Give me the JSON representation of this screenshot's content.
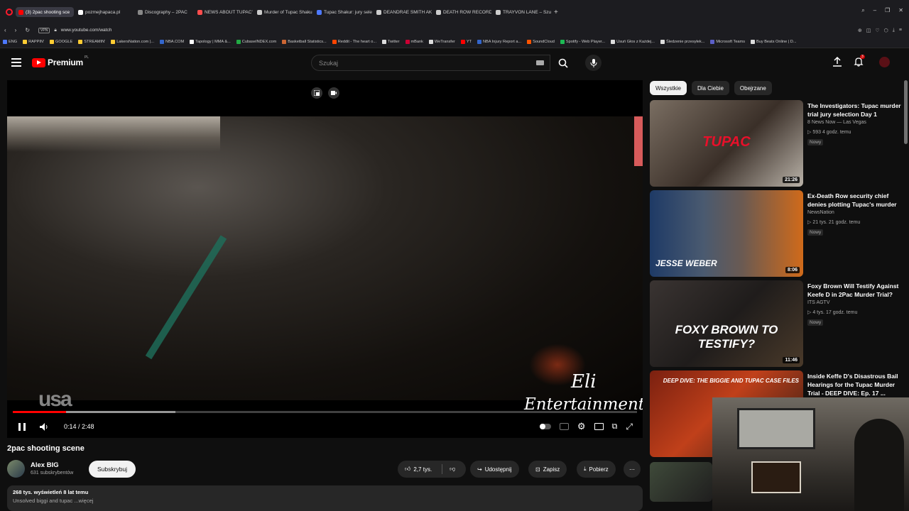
{
  "browser": {
    "tabs": [
      {
        "label": "(3) 2pac shooting sce",
        "color": "#ff0000",
        "active": true
      },
      {
        "label": "pozmejhapaca.pl",
        "color": "#ffffff"
      },
      {
        "label": "Discography – 2PAC",
        "color": "#888888"
      },
      {
        "label": "NEWS ABOUT TUPAC'S TI",
        "color": "#ff4d4d"
      },
      {
        "label": "Murder of Tupac Shakur",
        "color": "#cccccc"
      },
      {
        "label": "Tupac Shakur: jury selecti",
        "color": "#4d79ff"
      },
      {
        "label": "DEANDRAE SMITH AKA",
        "color": "#cccccc"
      },
      {
        "label": "DEATH ROW RECORDS PE",
        "color": "#cccccc"
      },
      {
        "label": "TRAYVON LANE – Szukaj",
        "color": "#cccccc"
      }
    ],
    "url": "www.youtube.com/watch",
    "vpn": "VPN",
    "bookmarks": [
      {
        "label": "ENG",
        "color": "#4d79ff"
      },
      {
        "label": "RAPPIN'",
        "color": "#ffcc33"
      },
      {
        "label": "GOOGLE",
        "color": "#ffcc33"
      },
      {
        "label": "STREAMIN'",
        "color": "#ffcc33"
      },
      {
        "label": "LakersNation.com |...",
        "color": "#ffcc33"
      },
      {
        "label": "NBA.COM",
        "color": "#3366cc"
      },
      {
        "label": "Tapology | MMA &...",
        "color": "#ffffff"
      },
      {
        "label": "CubaseINDEX.com",
        "color": "#22aa44"
      },
      {
        "label": "Basketball Statistics...",
        "color": "#cc6633"
      },
      {
        "label": "Reddit - The heart o...",
        "color": "#ff4500"
      },
      {
        "label": "Twitter",
        "color": "#dddddd"
      },
      {
        "label": "mBank",
        "color": "#cc0033"
      },
      {
        "label": "WeTransfer",
        "color": "#dddddd"
      },
      {
        "label": "YT",
        "color": "#ff0000"
      },
      {
        "label": "NBA Injury Report a...",
        "color": "#3366cc"
      },
      {
        "label": "SoundCloud",
        "color": "#ff5500"
      },
      {
        "label": "Spotify - Web Player...",
        "color": "#1db954"
      },
      {
        "label": "Usuń Głos z Każdej...",
        "color": "#dddddd"
      },
      {
        "label": "Śledzenie przesyłek...",
        "color": "#dddddd"
      },
      {
        "label": "Microsoft Teams",
        "color": "#5b5fc7"
      },
      {
        "label": "Buy Beats Online | D...",
        "color": "#dddddd"
      }
    ]
  },
  "header": {
    "logo_text": "Premium",
    "logo_region": "PL",
    "search_placeholder": "Szukaj",
    "notifications_count": "3"
  },
  "player": {
    "watermark_usa": "usa",
    "watermark_eli": "Eli",
    "watermark_ent": "Entertainment",
    "time": "0:14 / 2:48",
    "progress": 0.085,
    "buffered": 0.26
  },
  "video": {
    "title": "2pac shooting scene",
    "channel": "Alex BIG",
    "subscribers": "631 subskrybentów",
    "subscribe_label": "Subskrybuj",
    "likes": "2,7 tys.",
    "share_label": "Udostępnij",
    "save_label": "Zapisz",
    "download_label": "Pobierz",
    "views_line": "268 tys. wyświetleń  8 lat temu",
    "desc_preview": "Unsolved biggi and tupac ...więcej"
  },
  "sidebar": {
    "chips": [
      "Wszystkie",
      "Dla Ciebie",
      "Obejrzane"
    ],
    "recommendations": [
      {
        "title": "The Investigators: Tupac murder trial jury selection Day 1",
        "channel": "8 News Now — Las Vegas",
        "meta": "▷ 593  4 godz. temu",
        "badge": "Nowy",
        "duration": "21:26",
        "thumb_text": "TUPAC"
      },
      {
        "title": "Ex-Death Row security chief denies plotting Tupac's murder",
        "channel": "NewsNation",
        "meta": "▷ 21 tys.  21 godz. temu",
        "badge": "Nowy",
        "duration": "8:06",
        "thumb_text": "JESSE WEBER"
      },
      {
        "title": "Foxy Brown Will Testify Against Keefe D in 2Pac Murder Trial?",
        "channel": "ITS AGTV",
        "meta": "▷ 4 tys.  17 godz. temu",
        "badge": "Nowy",
        "duration": "11:46",
        "thumb_text": "FOXY BROWN TO TESTIFY?"
      },
      {
        "title": "Inside Keffe D's Disastrous Bail Hearings for the Tupac Murder Trial - DEEP DIVE: Ep. 17 ...",
        "channel": "",
        "meta": "",
        "badge": "",
        "duration": "",
        "thumb_text": "DEEP DIVE: THE BIGGIE AND TUPAC CASE FILES"
      }
    ]
  }
}
